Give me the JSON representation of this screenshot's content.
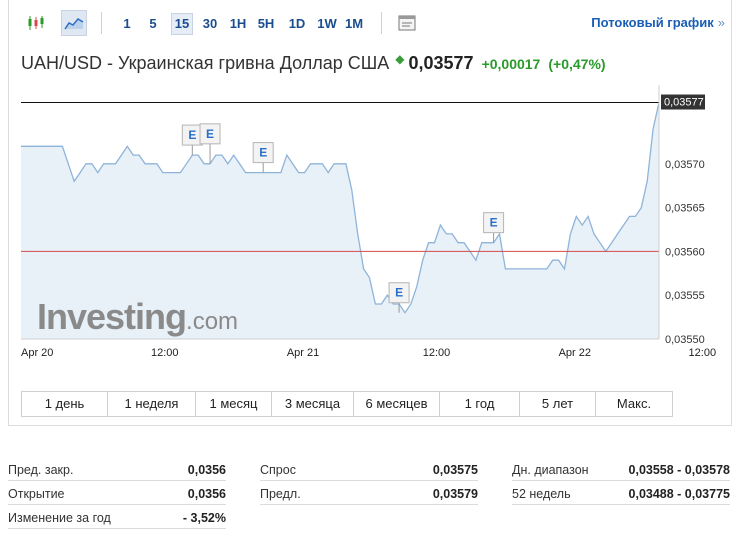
{
  "toolbar": {
    "timeframes": [
      "1",
      "5",
      "15",
      "30",
      "1H",
      "5H",
      "1D",
      "1W",
      "1M"
    ],
    "active_timeframe": "15",
    "stream_link": "Потоковый график",
    "stream_arrow": "»",
    "icons": [
      "candlestick-chart-icon",
      "area-chart-icon",
      "chart-window-icon"
    ]
  },
  "header": {
    "pair": "UAH/USD - Украинская гривна Доллар США",
    "price": "0,03577",
    "change": "+0,00017",
    "change_pct": "(+0,47%)",
    "dot": "◆"
  },
  "watermark": {
    "brand": "Investing",
    "suffix": ".com"
  },
  "colors": {
    "line": "#8fb4d9",
    "area": "#e8f0f8",
    "prev_close_line": "#d24b4b",
    "last_price_line": "#111111",
    "link": "#1a5fb4",
    "positive": "#2a9a2a"
  },
  "chart_data": {
    "type": "area",
    "x_tick_labels": [
      "Apr 20",
      "12:00",
      "Apr 21",
      "12:00",
      "Apr 22",
      "12:00"
    ],
    "y_tick_labels": [
      "0,03570",
      "0,03565",
      "0,03560",
      "0,03555",
      "0,03550"
    ],
    "last_price_label": "0,03577",
    "ylim": [
      0.0355,
      0.03579
    ],
    "prev_close": 0.0356,
    "last_price": 0.03577,
    "values": [
      0.03572,
      0.03572,
      0.03572,
      0.03572,
      0.03572,
      0.03572,
      0.03572,
      0.03572,
      0.0357,
      0.03568,
      0.03569,
      0.0357,
      0.0357,
      0.03569,
      0.0357,
      0.0357,
      0.0357,
      0.03571,
      0.03572,
      0.03571,
      0.03571,
      0.0357,
      0.0357,
      0.0357,
      0.03569,
      0.03569,
      0.03569,
      0.03569,
      0.0357,
      0.03571,
      0.03571,
      0.0357,
      0.0357,
      0.03571,
      0.03571,
      0.0357,
      0.03571,
      0.0357,
      0.03569,
      0.03569,
      0.03569,
      0.03569,
      0.03569,
      0.03569,
      0.03569,
      0.03571,
      0.0357,
      0.03569,
      0.03569,
      0.0357,
      0.0357,
      0.0357,
      0.03569,
      0.0357,
      0.0357,
      0.0357,
      0.03567,
      0.03562,
      0.03558,
      0.03557,
      0.03554,
      0.03554,
      0.03555,
      0.03554,
      0.03554,
      0.03553,
      0.03554,
      0.03556,
      0.03559,
      0.03561,
      0.03561,
      0.03563,
      0.03562,
      0.03562,
      0.03561,
      0.03561,
      0.0356,
      0.03559,
      0.03561,
      0.03561,
      0.03561,
      0.03562,
      0.03558,
      0.03558,
      0.03558,
      0.03558,
      0.03558,
      0.03558,
      0.03558,
      0.03558,
      0.03559,
      0.03559,
      0.03558,
      0.03562,
      0.03564,
      0.03563,
      0.03564,
      0.03562,
      0.03561,
      0.0356,
      0.03561,
      0.03562,
      0.03563,
      0.03564,
      0.03564,
      0.03565,
      0.03568,
      0.03574,
      0.03577
    ],
    "events": [
      {
        "label": "E",
        "index": 29,
        "value": 0.03571,
        "stack": 0
      },
      {
        "label": "E",
        "index": 32,
        "value": 0.0357,
        "stack": 1
      },
      {
        "label": "E",
        "index": 41,
        "value": 0.03569,
        "stack": 0
      },
      {
        "label": "E",
        "index": 64,
        "value": 0.03553,
        "stack": 0
      },
      {
        "label": "E",
        "index": 80,
        "value": 0.03561,
        "stack": 0
      }
    ]
  },
  "periods": [
    "1 день",
    "1 неделя",
    "1 месяц",
    "3 месяца",
    "6 месяцев",
    "1 год",
    "5 лет",
    "Макс."
  ],
  "stats": {
    "col1": [
      {
        "label": "Пред. закр.",
        "value": "0,0356"
      },
      {
        "label": "Открытие",
        "value": "0,0356"
      },
      {
        "label": "Изменение за год",
        "value": "- 3,52%"
      }
    ],
    "col2": [
      {
        "label": "Спрос",
        "value": "0,03575"
      },
      {
        "label": "Предл.",
        "value": "0,03579"
      }
    ],
    "col3": [
      {
        "label": "Дн. диапазон",
        "value": "0,03558 - 0,03578"
      },
      {
        "label": "52 недель",
        "value": "0,03488 - 0,03775"
      }
    ]
  }
}
